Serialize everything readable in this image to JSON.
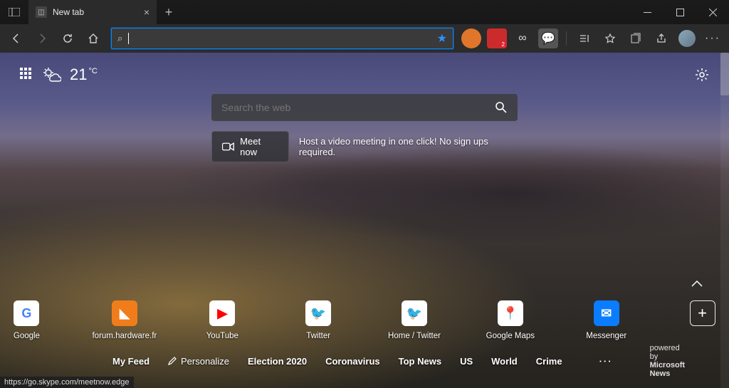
{
  "tab": {
    "title": "New tab"
  },
  "addressbar": {
    "value": "",
    "placeholder": ""
  },
  "ext_badge": "2",
  "weather": {
    "temp": "21",
    "unit": "°C"
  },
  "websearch": {
    "placeholder": "Search the web"
  },
  "meet": {
    "button": "Meet now",
    "desc": "Host a video meeting in one click! No sign ups required."
  },
  "tiles": [
    {
      "label": "Google",
      "bg": "#ffffff",
      "fg": "#4285F4",
      "glyph": "G"
    },
    {
      "label": "forum.hardware.fr",
      "bg": "#f07d1a",
      "fg": "#ffffff",
      "glyph": "◣"
    },
    {
      "label": "YouTube",
      "bg": "#ffffff",
      "fg": "#ff0000",
      "glyph": "▶"
    },
    {
      "label": "Twitter",
      "bg": "#ffffff",
      "fg": "#1DA1F2",
      "glyph": "🐦"
    },
    {
      "label": "Home / Twitter",
      "bg": "#ffffff",
      "fg": "#1DA1F2",
      "glyph": "🐦"
    },
    {
      "label": "Google Maps",
      "bg": "#ffffff",
      "fg": "#34A853",
      "glyph": "📍"
    },
    {
      "label": "Messenger",
      "bg": "#0a7cff",
      "fg": "#ffffff",
      "glyph": "✉"
    }
  ],
  "feed": {
    "myfeed": "My Feed",
    "personalize": "Personalize",
    "items": [
      "Election 2020",
      "Coronavirus",
      "Top News",
      "US",
      "World",
      "Crime"
    ],
    "powered_prefix": "powered by ",
    "powered_brand": "Microsoft News"
  },
  "status_url": "https://go.skype.com/meetnow.edge"
}
